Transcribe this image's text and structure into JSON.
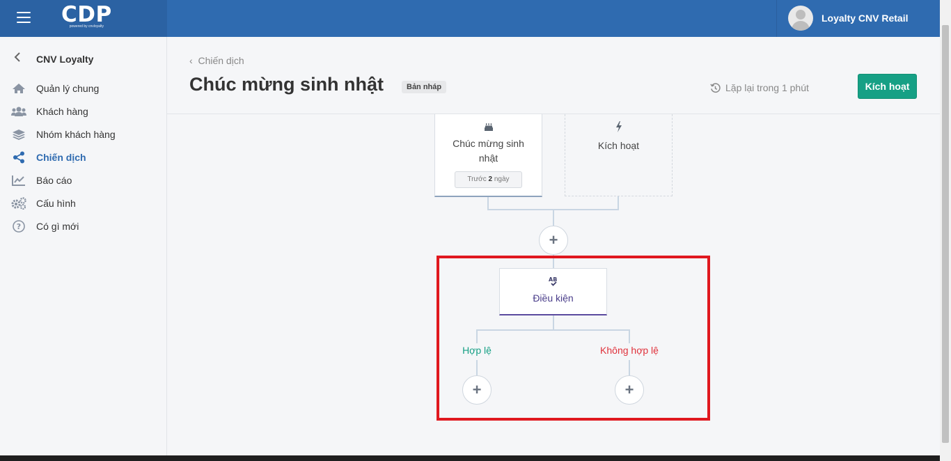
{
  "app": {
    "logo_text": "CDP",
    "logo_sub": "powered by cnvloyalty",
    "user_name": "Loyalty CNV Retail"
  },
  "sidebar": {
    "title": "CNV Loyalty",
    "items": [
      {
        "label": "Quản lý chung",
        "icon": "home-icon",
        "active": false
      },
      {
        "label": "Khách hàng",
        "icon": "users-icon",
        "active": false
      },
      {
        "label": "Nhóm khách hàng",
        "icon": "layers-icon",
        "active": false
      },
      {
        "label": "Chiến dịch",
        "icon": "share-icon",
        "active": true
      },
      {
        "label": "Báo cáo",
        "icon": "chart-icon",
        "active": false
      },
      {
        "label": "Cấu hình",
        "icon": "gears-icon",
        "active": false
      },
      {
        "label": "Có gì mới",
        "icon": "help-icon",
        "active": false
      }
    ]
  },
  "header": {
    "breadcrumb": "Chiến dịch",
    "title": "Chúc mừng sinh nhật",
    "badge": "Bản nháp",
    "repeat_text": "Lặp lại trong 1 phút",
    "activate_label": "Kích hoạt"
  },
  "flow": {
    "trigger_node": {
      "label": "Chúc mừng sinh nhật",
      "icon": "cake-icon",
      "tag_prefix": "Trước",
      "tag_value": "2",
      "tag_suffix": "ngày"
    },
    "action_node": {
      "label": "Kích hoạt",
      "icon": "bolt-icon"
    },
    "condition_node": {
      "label": "Điều kiện",
      "icon": "ab-check-icon"
    },
    "branch_valid": "Hợp lệ",
    "branch_invalid": "Không hợp lệ",
    "colors": {
      "valid": "#16a085",
      "invalid": "#e0323c",
      "accent": "#5b4a9e"
    }
  }
}
